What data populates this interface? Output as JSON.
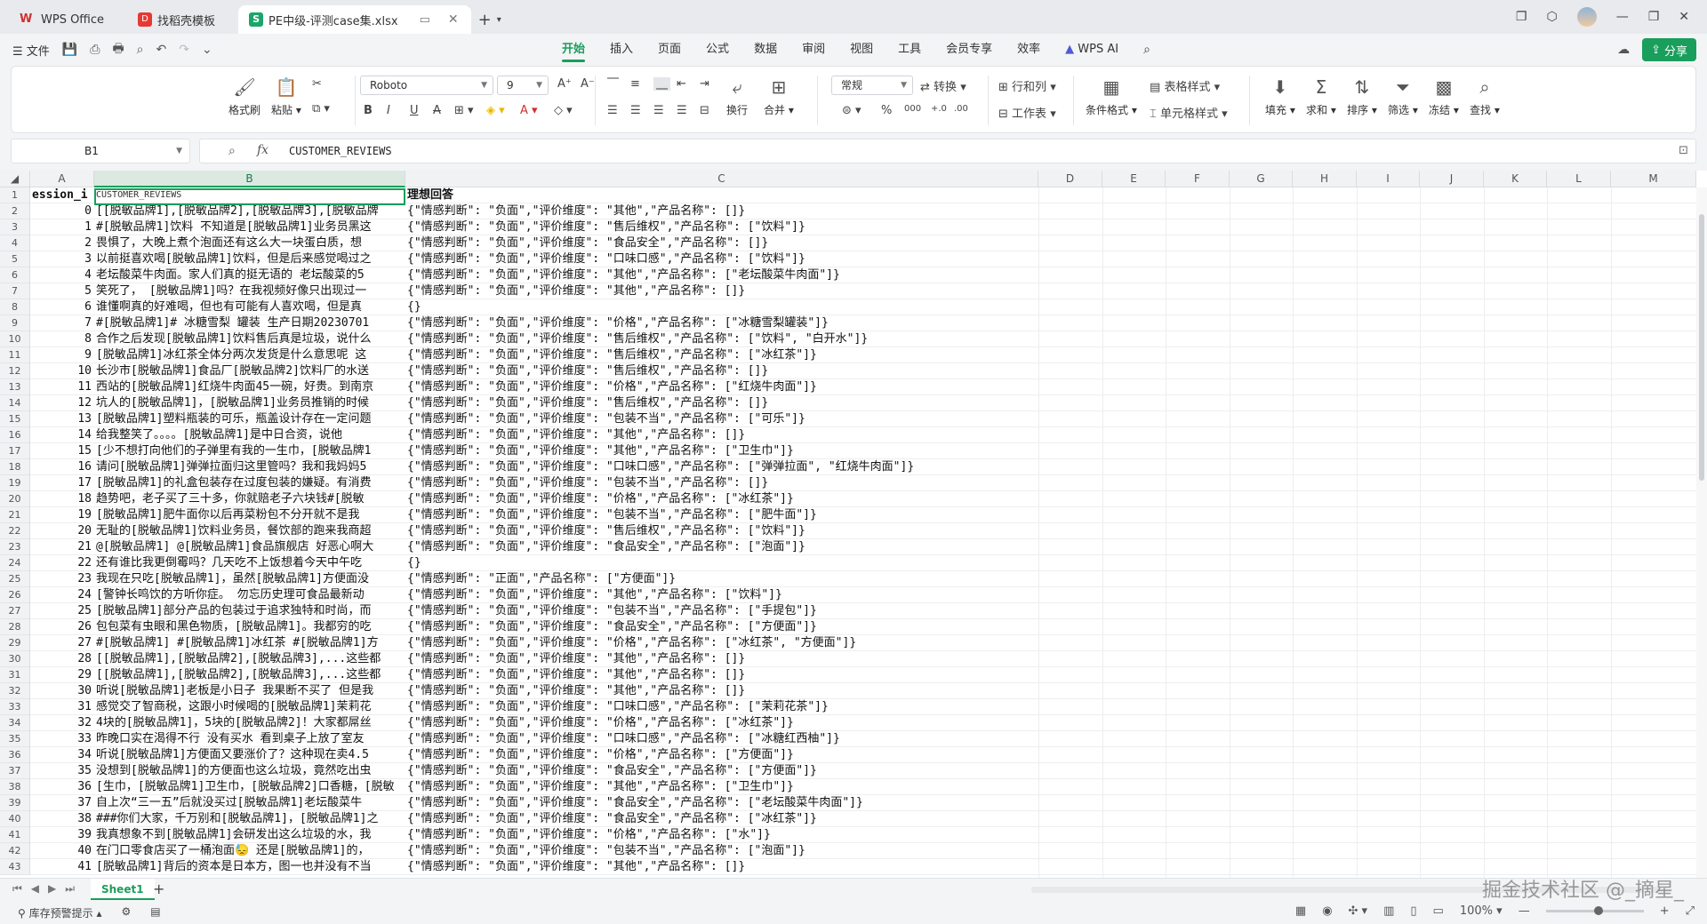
{
  "titlebar": {
    "tabs": [
      {
        "label": "WPS Office"
      },
      {
        "label": "找稻壳模板"
      },
      {
        "label": "PE中级-评测case集.xlsx"
      }
    ]
  },
  "menu": {
    "file": "文件",
    "tabs": [
      "开始",
      "插入",
      "页面",
      "公式",
      "数据",
      "审阅",
      "视图",
      "工具",
      "会员专享",
      "效率"
    ],
    "active_tab": "开始",
    "ai": "WPS AI",
    "share": "分享"
  },
  "ribbon": {
    "format_painter": "格式刷",
    "paste": "粘贴",
    "font_name": "Roboto",
    "font_size": "9",
    "number_format": "常规",
    "convert": "转换",
    "row_col": "行和列",
    "worksheet": "工作表",
    "wrap": "换行",
    "merge": "合并",
    "cond_format": "条件格式",
    "table_style": "表格样式",
    "cell_style": "单元格样式",
    "fill": "填充",
    "sum": "求和",
    "sort": "排序",
    "filter": "筛选",
    "freeze": "冻结",
    "find": "查找",
    "percent": "%"
  },
  "formula_bar": {
    "cell_ref": "B1",
    "value": "CUSTOMER_REVIEWS"
  },
  "columns": [
    "A",
    "B",
    "C",
    "D",
    "E",
    "F",
    "G",
    "H",
    "I",
    "J",
    "K",
    "L",
    "M"
  ],
  "grid": {
    "header": {
      "a": "ession_i",
      "b": "CUSTOMER_REVIEWS",
      "c": "理想回答"
    },
    "rows": [
      {
        "n": "2",
        "a": "0",
        "b": "[[脱敏品牌1],[脱敏品牌2],[脱敏品牌3],[脱敏品牌",
        "c": "{\"情感判断\": \"负面\",\"评价维度\": \"其他\",\"产品名称\": []}"
      },
      {
        "n": "3",
        "a": "1",
        "b": "#[脱敏品牌1]饮料 不知道是[脱敏品牌1]业务员黑这",
        "c": "{\"情感判断\": \"负面\",\"评价维度\": \"售后维权\",\"产品名称\": [\"饮料\"]}"
      },
      {
        "n": "4",
        "a": "2",
        "b": "畏惧了，大晚上煮个泡面还有这么大一块蛋白质，想",
        "c": "{\"情感判断\": \"负面\",\"评价维度\": \"食品安全\",\"产品名称\": []}"
      },
      {
        "n": "5",
        "a": "3",
        "b": "以前挺喜欢喝[脱敏品牌1]饮料，但是后来感觉喝过之",
        "c": "{\"情感判断\": \"负面\",\"评价维度\": \"口味口感\",\"产品名称\": [\"饮料\"]}"
      },
      {
        "n": "6",
        "a": "4",
        "b": "老坛酸菜牛肉面。家人们真的挺无语的 老坛酸菜的5",
        "c": "{\"情感判断\": \"负面\",\"评价维度\": \"其他\",\"产品名称\": [\"老坛酸菜牛肉面\"]}"
      },
      {
        "n": "7",
        "a": "5",
        "b": "笑死了， [脱敏品牌1]吗？在我视频好像只出现过一",
        "c": "{\"情感判断\": \"负面\",\"评价维度\": \"其他\",\"产品名称\": []}"
      },
      {
        "n": "8",
        "a": "6",
        "b": "谁懂啊真的好难喝，但也有可能有人喜欢喝，但是真",
        "c": "{}"
      },
      {
        "n": "9",
        "a": "7",
        "b": "#[脱敏品牌1]# 冰糖雪梨 罐装 生产日期20230701",
        "c": "{\"情感判断\": \"负面\",\"评价维度\": \"价格\",\"产品名称\": [\"冰糖雪梨罐装\"]}"
      },
      {
        "n": "10",
        "a": "8",
        "b": "合作之后发现[脱敏品牌1]饮料售后真是垃圾，说什么",
        "c": "{\"情感判断\": \"负面\",\"评价维度\": \"售后维权\",\"产品名称\": [\"饮料\", \"白开水\"]}"
      },
      {
        "n": "11",
        "a": "9",
        "b": "[脱敏品牌1]冰红茶全体分两次发货是什么意思呢 这",
        "c": "{\"情感判断\": \"负面\",\"评价维度\": \"售后维权\",\"产品名称\": [\"冰红茶\"]}"
      },
      {
        "n": "12",
        "a": "10",
        "b": "长沙市[脱敏品牌1]食品厂[脱敏品牌2]饮料厂的水送",
        "c": "{\"情感判断\": \"负面\",\"评价维度\": \"售后维权\",\"产品名称\": []}"
      },
      {
        "n": "13",
        "a": "11",
        "b": "西站的[脱敏品牌1]红烧牛肉面45一碗，好贵。到南京",
        "c": "{\"情感判断\": \"负面\",\"评价维度\": \"价格\",\"产品名称\": [\"红烧牛肉面\"]}"
      },
      {
        "n": "14",
        "a": "12",
        "b": "坑人的[脱敏品牌1]，[脱敏品牌1]业务员推销的时候",
        "c": "{\"情感判断\": \"负面\",\"评价维度\": \"售后维权\",\"产品名称\": []}"
      },
      {
        "n": "15",
        "a": "13",
        "b": "[脱敏品牌1]塑料瓶装的可乐，瓶盖设计存在一定问题",
        "c": "{\"情感判断\": \"负面\",\"评价维度\": \"包装不当\",\"产品名称\": [\"可乐\"]}"
      },
      {
        "n": "16",
        "a": "14",
        "b": "给我整笑了。。。。[脱敏品牌1]是中日合资，说他",
        "c": "{\"情感判断\": \"负面\",\"评价维度\": \"其他\",\"产品名称\": []}"
      },
      {
        "n": "17",
        "a": "15",
        "b": "[少不想打向他们的子弹里有我的一生巾，[脱敏品牌1",
        "c": "{\"情感判断\": \"负面\",\"评价维度\": \"其他\",\"产品名称\": [\"卫生巾\"]}"
      },
      {
        "n": "18",
        "a": "16",
        "b": "请问[脱敏品牌1]弹弹拉面归这里管吗？我和我妈妈5",
        "c": "{\"情感判断\": \"负面\",\"评价维度\": \"口味口感\",\"产品名称\": [\"弹弹拉面\", \"红烧牛肉面\"]}"
      },
      {
        "n": "19",
        "a": "17",
        "b": "[脱敏品牌1]的礼盒包装存在过度包装的嫌疑。有消费",
        "c": "{\"情感判断\": \"负面\",\"评价维度\": \"包装不当\",\"产品名称\": []}"
      },
      {
        "n": "20",
        "a": "18",
        "b": "趋势吧，老子买了三十多，你就赔老子六块钱#[脱敏",
        "c": "{\"情感判断\": \"负面\",\"评价维度\": \"价格\",\"产品名称\": [\"冰红茶\"]}"
      },
      {
        "n": "21",
        "a": "19",
        "b": "[脱敏品牌1]肥牛面你以后再菜粉包不分开就不是我",
        "c": "{\"情感判断\": \"负面\",\"评价维度\": \"包装不当\",\"产品名称\": [\"肥牛面\"]}"
      },
      {
        "n": "22",
        "a": "20",
        "b": "无耻的[脱敏品牌1]饮料业务员，餐饮部的跑来我商超",
        "c": "{\"情感判断\": \"负面\",\"评价维度\": \"售后维权\",\"产品名称\": [\"饮料\"]}"
      },
      {
        "n": "23",
        "a": "21",
        "b": "@[脱敏品牌1] @[脱敏品牌1]食品旗舰店 好恶心啊大",
        "c": "{\"情感判断\": \"负面\",\"评价维度\": \"食品安全\",\"产品名称\": [\"泡面\"]}"
      },
      {
        "n": "24",
        "a": "22",
        "b": "还有谁比我更倒霉吗？几天吃不上饭想着今天中午吃",
        "c": "{}"
      },
      {
        "n": "25",
        "a": "23",
        "b": "我现在只吃[脱敏品牌1]，虽然[脱敏品牌1]方便面没",
        "c": "{\"情感判断\": \"正面\",\"产品名称\": [\"方便面\"]}"
      },
      {
        "n": "26",
        "a": "24",
        "b": "[警钟长鸣饮的方听你症。 勿忘历史理可食品最新动",
        "c": "{\"情感判断\": \"负面\",\"评价维度\": \"其他\",\"产品名称\": [\"饮料\"]}"
      },
      {
        "n": "27",
        "a": "25",
        "b": "[脱敏品牌1]部分产品的包装过于追求独特和时尚，而",
        "c": "{\"情感判断\": \"负面\",\"评价维度\": \"包装不当\",\"产品名称\": [\"手提包\"]}"
      },
      {
        "n": "28",
        "a": "26",
        "b": "包包菜有虫眼和黑色物质，[脱敏品牌1]。我都穷的吃",
        "c": "{\"情感判断\": \"负面\",\"评价维度\": \"食品安全\",\"产品名称\": [\"方便面\"]}"
      },
      {
        "n": "29",
        "a": "27",
        "b": "#[脱敏品牌1] #[脱敏品牌1]冰红茶 #[脱敏品牌1]方",
        "c": "{\"情感判断\": \"负面\",\"评价维度\": \"价格\",\"产品名称\": [\"冰红茶\", \"方便面\"]}"
      },
      {
        "n": "30",
        "a": "28",
        "b": "[[脱敏品牌1],[脱敏品牌2],[脱敏品牌3],...这些都",
        "c": "{\"情感判断\": \"负面\",\"评价维度\": \"其他\",\"产品名称\": []}"
      },
      {
        "n": "31",
        "a": "29",
        "b": "[[脱敏品牌1],[脱敏品牌2],[脱敏品牌3],...这些都",
        "c": "{\"情感判断\": \"负面\",\"评价维度\": \"其他\",\"产品名称\": []}"
      },
      {
        "n": "32",
        "a": "30",
        "b": "听说[脱敏品牌1]老板是小日子 我果断不买了 但是我",
        "c": "{\"情感判断\": \"负面\",\"评价维度\": \"其他\",\"产品名称\": []}"
      },
      {
        "n": "33",
        "a": "31",
        "b": "感觉交了智商税，这跟小时候喝的[脱敏品牌1]茉莉花",
        "c": "{\"情感判断\": \"负面\",\"评价维度\": \"口味口感\",\"产品名称\": [\"茉莉花茶\"]}"
      },
      {
        "n": "34",
        "a": "32",
        "b": "4块的[脱敏品牌1]，5块的[脱敏品牌2]！大家都屌丝",
        "c": "{\"情感判断\": \"负面\",\"评价维度\": \"价格\",\"产品名称\": [\"冰红茶\"]}"
      },
      {
        "n": "35",
        "a": "33",
        "b": "昨晚口实在渴得不行 没有买水 看到桌子上放了室友",
        "c": "{\"情感判断\": \"负面\",\"评价维度\": \"口味口感\",\"产品名称\": [\"冰糖红西柚\"]}"
      },
      {
        "n": "36",
        "a": "34",
        "b": "听说[脱敏品牌1]方便面又要涨价了？这种现在卖4.5",
        "c": "{\"情感判断\": \"负面\",\"评价维度\": \"价格\",\"产品名称\": [\"方便面\"]}"
      },
      {
        "n": "37",
        "a": "35",
        "b": "没想到[脱敏品牌1]的方便面也这么垃圾，竟然吃出虫",
        "c": "{\"情感判断\": \"负面\",\"评价维度\": \"食品安全\",\"产品名称\": [\"方便面\"]}"
      },
      {
        "n": "38",
        "a": "36",
        "b": "[生巾，[脱敏品牌1]卫生巾，[脱敏品牌2]口香糖，[脱敏",
        "c": "{\"情感判断\": \"负面\",\"评价维度\": \"其他\",\"产品名称\": [\"卫生巾\"]}"
      },
      {
        "n": "39",
        "a": "37",
        "b": "自上次“三一五”后就没买过[脱敏品牌1]老坛酸菜牛",
        "c": "{\"情感判断\": \"负面\",\"评价维度\": \"食品安全\",\"产品名称\": [\"老坛酸菜牛肉面\"]}"
      },
      {
        "n": "40",
        "a": "38",
        "b": "###你们大家，千万别和[脱敏品牌1]，[脱敏品牌1]之",
        "c": "{\"情感判断\": \"负面\",\"评价维度\": \"食品安全\",\"产品名称\": [\"冰红茶\"]}"
      },
      {
        "n": "41",
        "a": "39",
        "b": "我真想象不到[脱敏品牌1]会研发出这么垃圾的水，我",
        "c": "{\"情感判断\": \"负面\",\"评价维度\": \"价格\",\"产品名称\": [\"水\"]}"
      },
      {
        "n": "42",
        "a": "40",
        "b": "在门口零食店买了一桶泡面😓 还是[脱敏品牌1]的，",
        "c": "{\"情感判断\": \"负面\",\"评价维度\": \"包装不当\",\"产品名称\": [\"泡面\"]}"
      },
      {
        "n": "43",
        "a": "41",
        "b": "[脱敏品牌1]背后的资本是日本方，图一也并没有不当",
        "c": "{\"情感判断\": \"负面\",\"评价维度\": \"其他\",\"产品名称\": []}"
      }
    ]
  },
  "sheet_tabs": {
    "active": "Sheet1"
  },
  "status": {
    "hint": "库存预警提示",
    "zoom": "100%"
  },
  "watermark": "掘金技术社区 @_摘星_"
}
